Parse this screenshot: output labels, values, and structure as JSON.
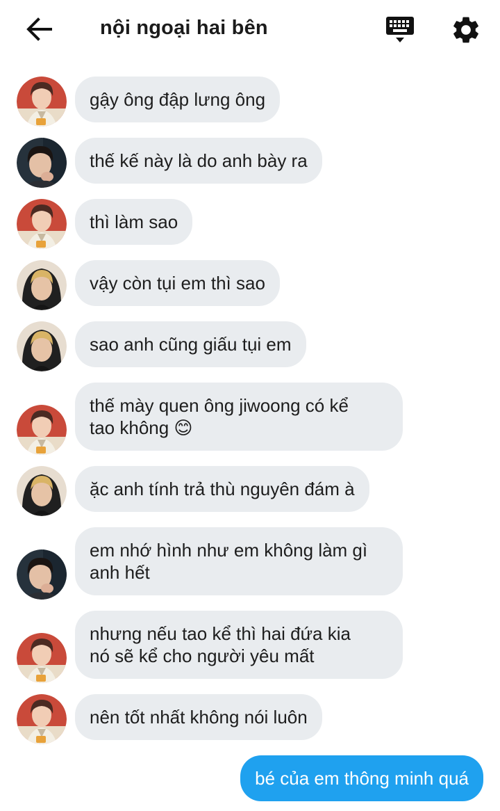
{
  "header": {
    "title": "nội ngoại hai bên",
    "back_icon": "arrow-left-icon",
    "keyboard_icon": "keyboard-icon",
    "settings_icon": "gear-icon"
  },
  "colors": {
    "incoming_bubble": "#e9ecef",
    "outgoing_bubble": "#1fa1ef",
    "text": "#1d1d1d"
  },
  "messages": [
    {
      "sender": "red-hair",
      "text": "gậy ông đập lưng ông"
    },
    {
      "sender": "dark-hair",
      "text": "thế kế này là do anh bày ra"
    },
    {
      "sender": "red-hair",
      "text": "thì làm sao"
    },
    {
      "sender": "blonde-hood",
      "text": "vậy còn tụi em thì sao"
    },
    {
      "sender": "blonde-hood",
      "text": "sao anh cũng giấu tụi em"
    },
    {
      "sender": "red-hair",
      "line1": "thế mày quen ông jiwoong có kể",
      "line2": "tao không 😊"
    },
    {
      "sender": "blonde-hood",
      "text": "ặc anh tính trả thù nguyên đám à"
    },
    {
      "sender": "dark-hair",
      "line1": "em nhớ hình như em không làm gì",
      "line2": "anh hết"
    },
    {
      "sender": "red-hair",
      "line1": "nhưng nếu tao kể thì hai đứa kia",
      "line2": "nó sẽ kể cho người yêu mất"
    },
    {
      "sender": "red-hair",
      "text": "nên tốt nhất không nói luôn"
    },
    {
      "sender": "me",
      "text": "bé của em thông minh quá"
    }
  ]
}
